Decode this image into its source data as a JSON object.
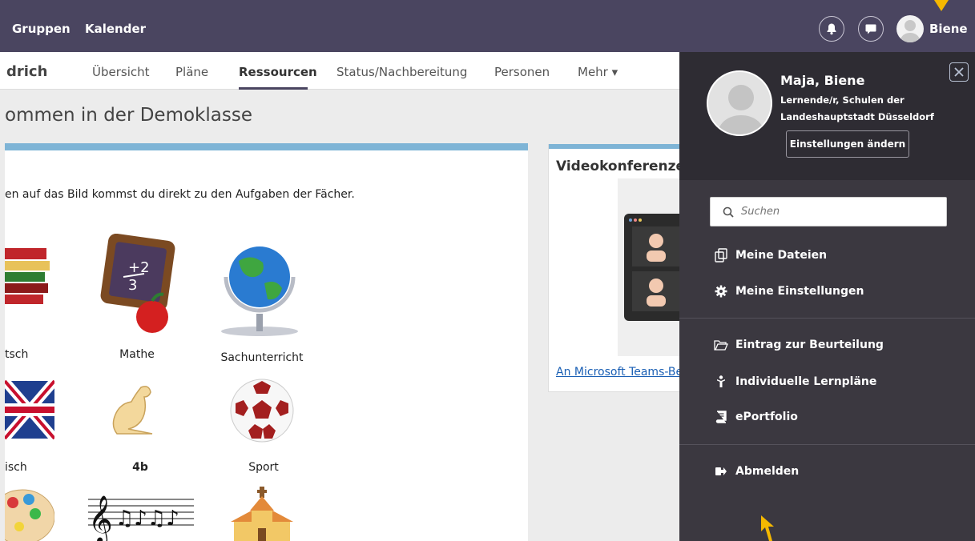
{
  "topnav": {
    "links": [
      "Gruppen",
      "Kalender"
    ],
    "user_name": "Biene",
    "bell_icon": "bell-icon",
    "chat_icon": "chat-icon"
  },
  "subnav": {
    "title": "drich",
    "tabs": [
      "Übersicht",
      "Pläne",
      "Ressourcen",
      "Status/Nachbereitung",
      "Personen",
      "Mehr ▾"
    ],
    "active_tab": "Ressourcen"
  },
  "page": {
    "heading": "ommen in der Demoklasse"
  },
  "main_card": {
    "intro": "en auf das Bild kommst du direkt zu den Aufgaben der Fächer.",
    "subjects": [
      "tsch",
      "Mathe",
      "Sachunterricht",
      "isch",
      "4b",
      "Sport"
    ]
  },
  "video_card": {
    "title": "Videokonferenzen",
    "link": "An Microsoft Teams-Besprechung"
  },
  "panel": {
    "name": "Maja, Biene",
    "role": "Lernende/r, Schulen der Landeshauptstadt Düsseldorf",
    "settings_button": "Einstellungen ändern",
    "search_placeholder": "Suchen",
    "menu": [
      "Meine Dateien",
      "Meine Einstellungen",
      "Eintrag zur Beurteilung",
      "Individuelle Lernpläne",
      "ePortfolio",
      "Abmelden"
    ]
  },
  "colors": {
    "topnav": "#4a4560",
    "panel": "#3b3840",
    "accent_blue": "#7eb4d6",
    "arrow": "#f5b800"
  }
}
